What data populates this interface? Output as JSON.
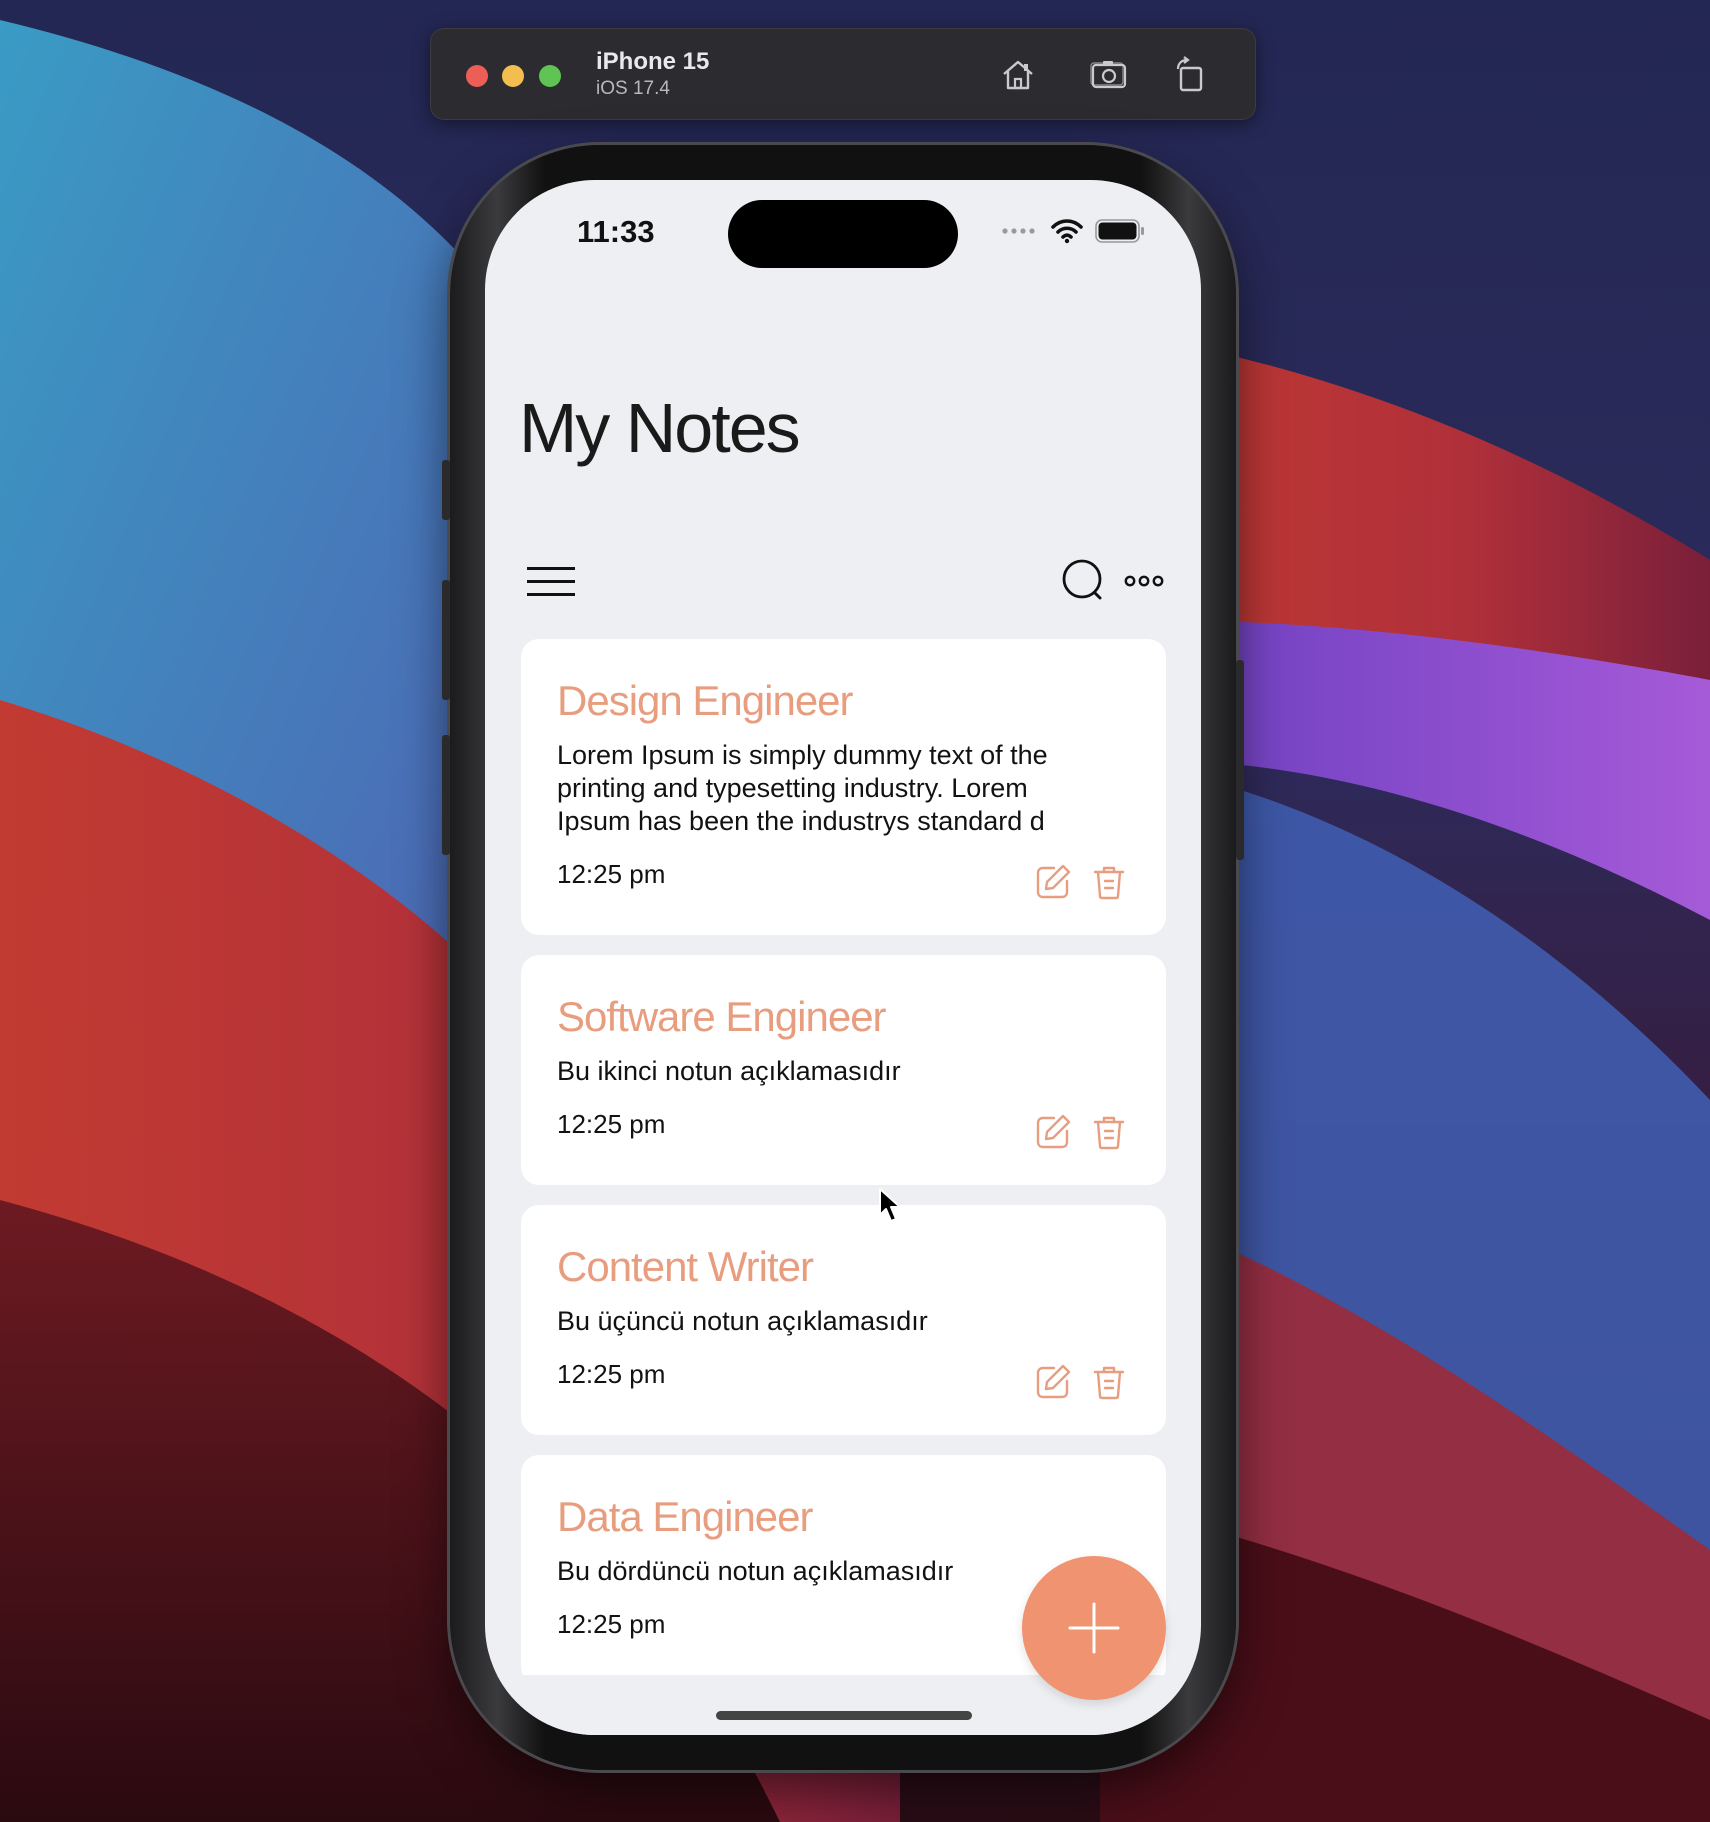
{
  "simulator": {
    "device_name": "iPhone 15",
    "os_version": "iOS 17.4",
    "buttons": [
      "home-icon",
      "screenshot-icon",
      "rotate-icon"
    ]
  },
  "status_bar": {
    "time": "11:33"
  },
  "app": {
    "title": "My Notes",
    "accent_color": "#ef9370",
    "title_color": "#e99d7f"
  },
  "notes": [
    {
      "title": "Design Engineer",
      "description": "Lorem Ipsum is simply dummy text of the printing and typesetting industry. Lorem Ipsum has been the industrys standard d",
      "time": "12:25 pm"
    },
    {
      "title": "Software Engineer",
      "description": "Bu ikinci notun açıklamasıdır",
      "time": "12:25 pm"
    },
    {
      "title": "Content Writer",
      "description": "Bu üçüncü notun açıklamasıdır",
      "time": "12:25 pm"
    },
    {
      "title": "Data Engineer",
      "description": "Bu dördüncü notun açıklamasıdır",
      "time": "12:25 pm"
    }
  ]
}
